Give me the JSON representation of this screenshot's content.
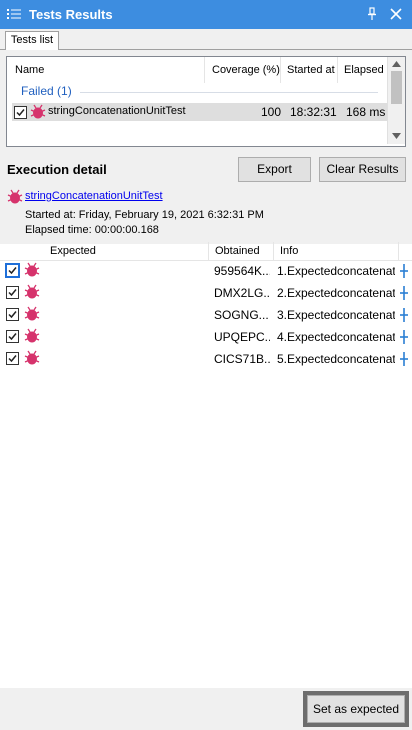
{
  "window": {
    "title": "Tests Results"
  },
  "tabs": [
    {
      "label": "Tests list"
    }
  ],
  "tests_list": {
    "columns": [
      "Name",
      "Coverage (%)",
      "Started at",
      "Elapsed"
    ],
    "group_label": "Failed (1)",
    "rows": [
      {
        "name": "stringConcatenationUnitTest",
        "coverage": "100",
        "started": "18:32:31",
        "elapsed": "168 ms",
        "checked": true
      }
    ]
  },
  "execution": {
    "title": "Execution detail",
    "export_label": "Export",
    "clear_label": "Clear Results",
    "test_link": "stringConcatenationUnitTest",
    "started_text": "Started at: Friday, February 19, 2021 6:32:31 PM",
    "elapsed_text": "Elapsed time: 00:00:00.168"
  },
  "results": {
    "columns": [
      "Expected",
      "Obtained",
      "Info"
    ],
    "rows": [
      {
        "expected": "",
        "obtained": "959564K...",
        "info": "1.Expectedconcatenat...",
        "checked": true
      },
      {
        "expected": "",
        "obtained": "DMX2LG...",
        "info": "2.Expectedconcatenat...",
        "checked": true
      },
      {
        "expected": "",
        "obtained": "SOGNG...",
        "info": "3.Expectedconcatenat...",
        "checked": true
      },
      {
        "expected": "",
        "obtained": "UPQEPC...",
        "info": "4.Expectedconcatenat...",
        "checked": true
      },
      {
        "expected": "",
        "obtained": "CICS71B...",
        "info": "5.Expectedconcatenat...",
        "checked": true
      }
    ]
  },
  "footer": {
    "set_expected_label": "Set as expected"
  },
  "colors": {
    "titlebar": "#3d8de0",
    "link": "#0000ee",
    "group": "#1f5fbf",
    "bug_icon": "#d6336c"
  },
  "icons": [
    "list-icon",
    "pin-icon",
    "close-icon",
    "bug-icon",
    "checkbox-checked-icon",
    "plus-icon"
  ]
}
